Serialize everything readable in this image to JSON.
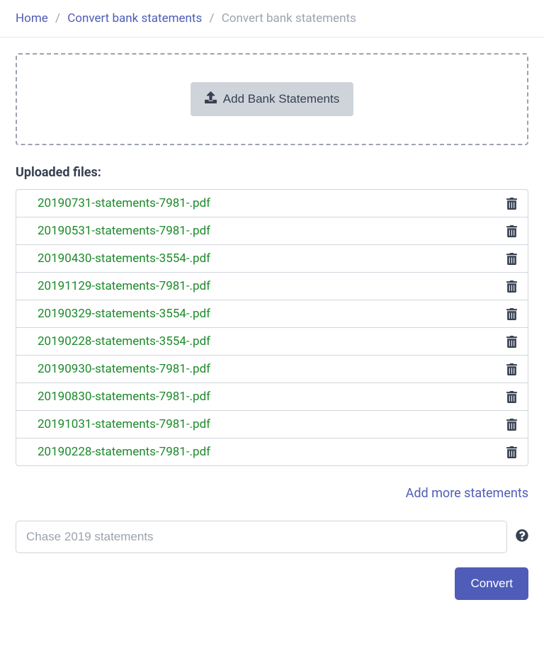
{
  "breadcrumb": {
    "home": "Home",
    "section": "Convert bank statements",
    "current": "Convert bank statements"
  },
  "dropzone": {
    "button_label": "Add Bank Statements"
  },
  "uploaded": {
    "title": "Uploaded files:",
    "files": [
      "20190731-statements-7981-.pdf",
      "20190531-statements-7981-.pdf",
      "20190430-statements-3554-.pdf",
      "20191129-statements-7981-.pdf",
      "20190329-statements-3554-.pdf",
      "20190228-statements-3554-.pdf",
      "20190930-statements-7981-.pdf",
      "20190830-statements-7981-.pdf",
      "20191031-statements-7981-.pdf",
      "20190228-statements-7981-.pdf"
    ]
  },
  "add_more_label": "Add more statements",
  "name_input": {
    "placeholder": "Chase 2019 statements"
  },
  "convert_label": "Convert"
}
